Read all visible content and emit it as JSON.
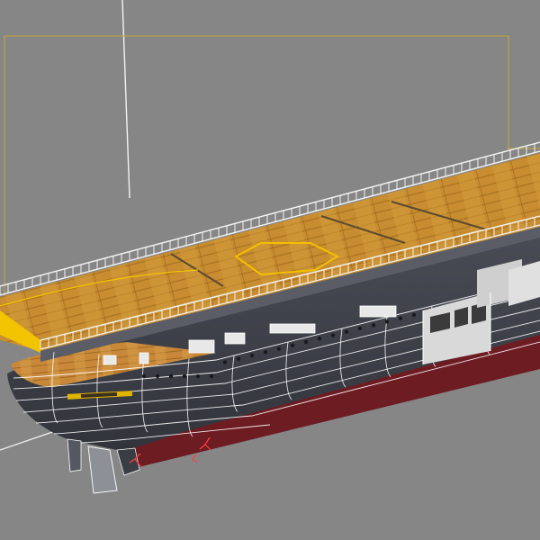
{
  "viewport": {
    "background": "#868686",
    "selection_bracket_color": "#c8a63a",
    "wireframe_color": "#ffffff"
  },
  "model": {
    "deck_color": "#c99032",
    "deck_trim_color": "#f2c400",
    "hull_color": "#3d3f48",
    "waterline_color": "#7a1f24"
  }
}
